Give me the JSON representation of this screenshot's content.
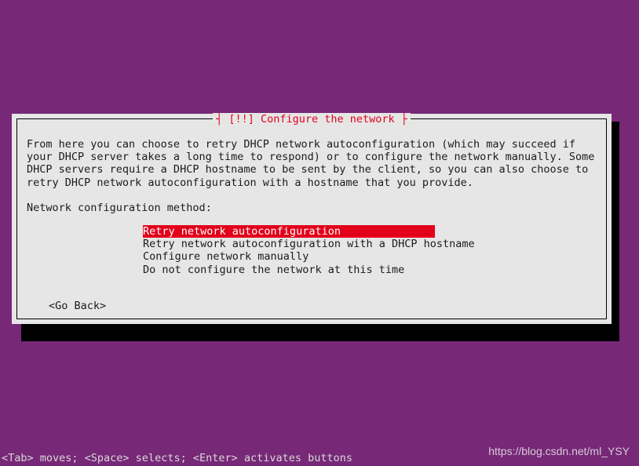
{
  "dialog": {
    "title_prefix": "┤ ",
    "title_flag": "[!!]",
    "title_text": " Configure the network",
    "title_suffix": " ├",
    "body": "From here you can choose to retry DHCP network autoconfiguration (which may succeed if your DHCP server takes a long time to respond) or to configure the network manually. Some DHCP servers require a DHCP hostname to be sent by the client, so you can also choose to retry DHCP network autoconfiguration with a hostname that you provide.",
    "prompt": "Network configuration method:",
    "options": [
      {
        "label": "Retry network autoconfiguration",
        "selected": true
      },
      {
        "label": "Retry network autoconfiguration with a DHCP hostname",
        "selected": false
      },
      {
        "label": "Configure network manually",
        "selected": false
      },
      {
        "label": "Do not configure the network at this time",
        "selected": false
      }
    ],
    "back": "<Go Back>"
  },
  "hint": "<Tab> moves; <Space> selects; <Enter> activates buttons",
  "watermark": "https://blog.csdn.net/ml_YSY",
  "colors": {
    "accent": "#e2001a",
    "bg": "#772877",
    "panel": "#e6e6e6"
  }
}
